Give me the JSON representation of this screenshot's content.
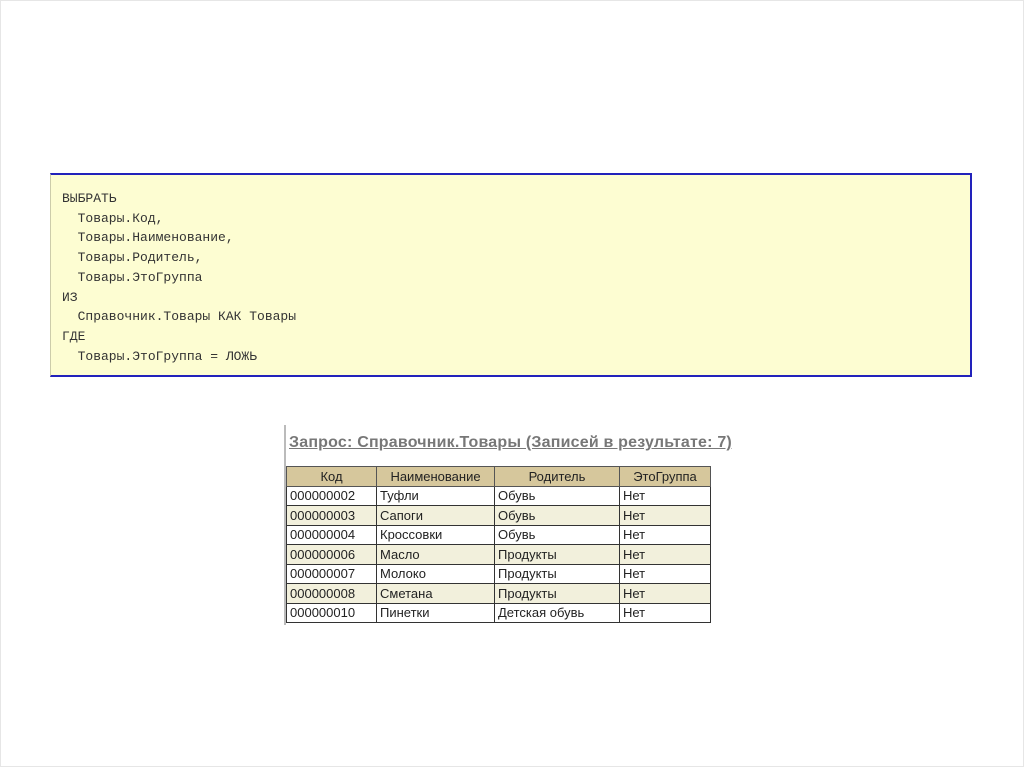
{
  "query_lines": [
    "ВЫБРАТЬ",
    "  Товары.Код,",
    "  Товары.Наименование,",
    "  Товары.Родитель,",
    "  Товары.ЭтоГруппа",
    "ИЗ",
    "  Справочник.Товары КАК Товары",
    "ГДЕ",
    "  Товары.ЭтоГруппа = ЛОЖЬ"
  ],
  "result": {
    "title": "Запрос: Справочник.Товары (Записей в результате: 7)",
    "columns": [
      "Код",
      "Наименование",
      "Родитель",
      "ЭтоГруппа"
    ],
    "rows": [
      [
        "000000002",
        "Туфли",
        "Обувь",
        "Нет"
      ],
      [
        "000000003",
        "Сапоги",
        "Обувь",
        "Нет"
      ],
      [
        "000000004",
        "Кроссовки",
        "Обувь",
        "Нет"
      ],
      [
        "000000006",
        "Масло",
        "Продукты",
        "Нет"
      ],
      [
        "000000007",
        "Молоко",
        "Продукты",
        "Нет"
      ],
      [
        "000000008",
        "Сметана",
        "Продукты",
        "Нет"
      ],
      [
        "000000010",
        "Пинетки",
        "Детская обувь",
        "Нет"
      ]
    ]
  }
}
